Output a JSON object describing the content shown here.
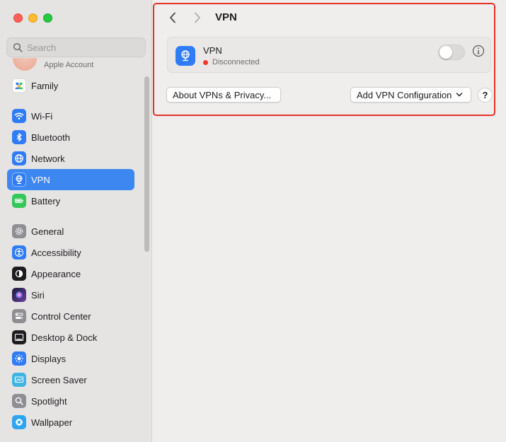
{
  "sidebar": {
    "search_placeholder": "Search",
    "account_label": "Apple Account",
    "items": [
      {
        "label": "Family",
        "icon": "family-icon",
        "color": "#ffffff"
      },
      {
        "label": "Wi-Fi",
        "icon": "wifi-icon",
        "color": "#2f7cf6"
      },
      {
        "label": "Bluetooth",
        "icon": "bluetooth-icon",
        "color": "#2f7cf6"
      },
      {
        "label": "Network",
        "icon": "globe-icon",
        "color": "#2f7cf6"
      },
      {
        "label": "VPN",
        "icon": "vpn-icon",
        "color": "#2f7cf6"
      },
      {
        "label": "Battery",
        "icon": "battery-icon",
        "color": "#34c759"
      },
      {
        "label": "General",
        "icon": "gear-icon",
        "color": "#8e8e93"
      },
      {
        "label": "Accessibility",
        "icon": "accessibility-icon",
        "color": "#2f7cf6"
      },
      {
        "label": "Appearance",
        "icon": "appearance-icon",
        "color": "#1d1d1f"
      },
      {
        "label": "Siri",
        "icon": "siri-icon",
        "color": "#6b3fa0"
      },
      {
        "label": "Control Center",
        "icon": "control-center-icon",
        "color": "#8e8e93"
      },
      {
        "label": "Desktop & Dock",
        "icon": "dock-icon",
        "color": "#1d1d1f"
      },
      {
        "label": "Displays",
        "icon": "sun-icon",
        "color": "#2f7cf6"
      },
      {
        "label": "Screen Saver",
        "icon": "screen-saver-icon",
        "color": "#40b4e0"
      },
      {
        "label": "Spotlight",
        "icon": "magnifier-icon",
        "color": "#8e8e93"
      },
      {
        "label": "Wallpaper",
        "icon": "wallpaper-icon",
        "color": "#2fa5f0"
      }
    ]
  },
  "header": {
    "title": "VPN"
  },
  "vpn": {
    "name": "VPN",
    "status": "Disconnected",
    "status_color": "#f2362b"
  },
  "buttons": {
    "about": "About VPNs & Privacy...",
    "add": "Add VPN Configuration",
    "help": "?"
  }
}
